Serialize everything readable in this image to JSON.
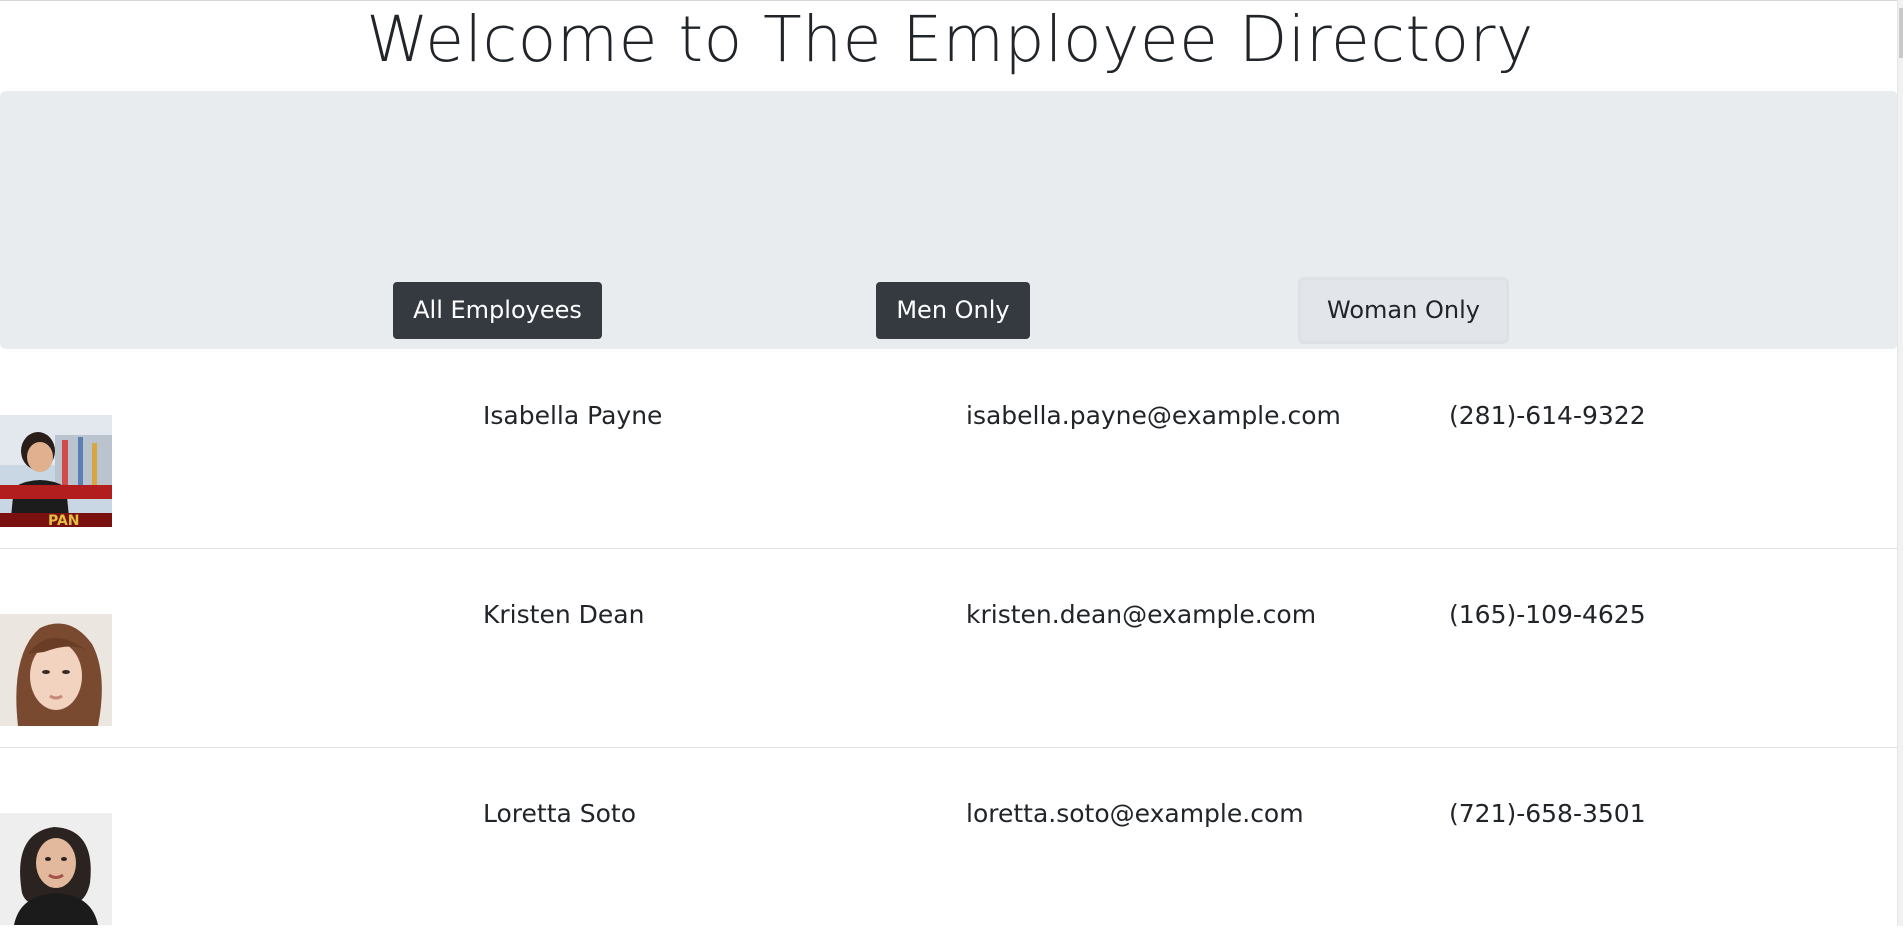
{
  "page": {
    "title": "Welcome to The Employee Directory"
  },
  "filters": {
    "all_label": "All Employees",
    "men_label": "Men Only",
    "women_label": "Woman Only"
  },
  "employees": [
    {
      "name": "Isabella Payne",
      "email": "isabella.payne@example.com",
      "phone": "(281)-614-9322",
      "photo": "photo-isabella-payne"
    },
    {
      "name": "Kristen Dean",
      "email": "kristen.dean@example.com",
      "phone": "(165)-109-4625",
      "photo": "photo-kristen-dean"
    },
    {
      "name": "Loretta Soto",
      "email": "loretta.soto@example.com",
      "phone": "(721)-658-3501",
      "photo": "photo-loretta-soto"
    }
  ],
  "colors": {
    "jumbotron_bg": "#e9ecef",
    "dark_button": "#343a40",
    "light_button": "#e2e5e9"
  }
}
